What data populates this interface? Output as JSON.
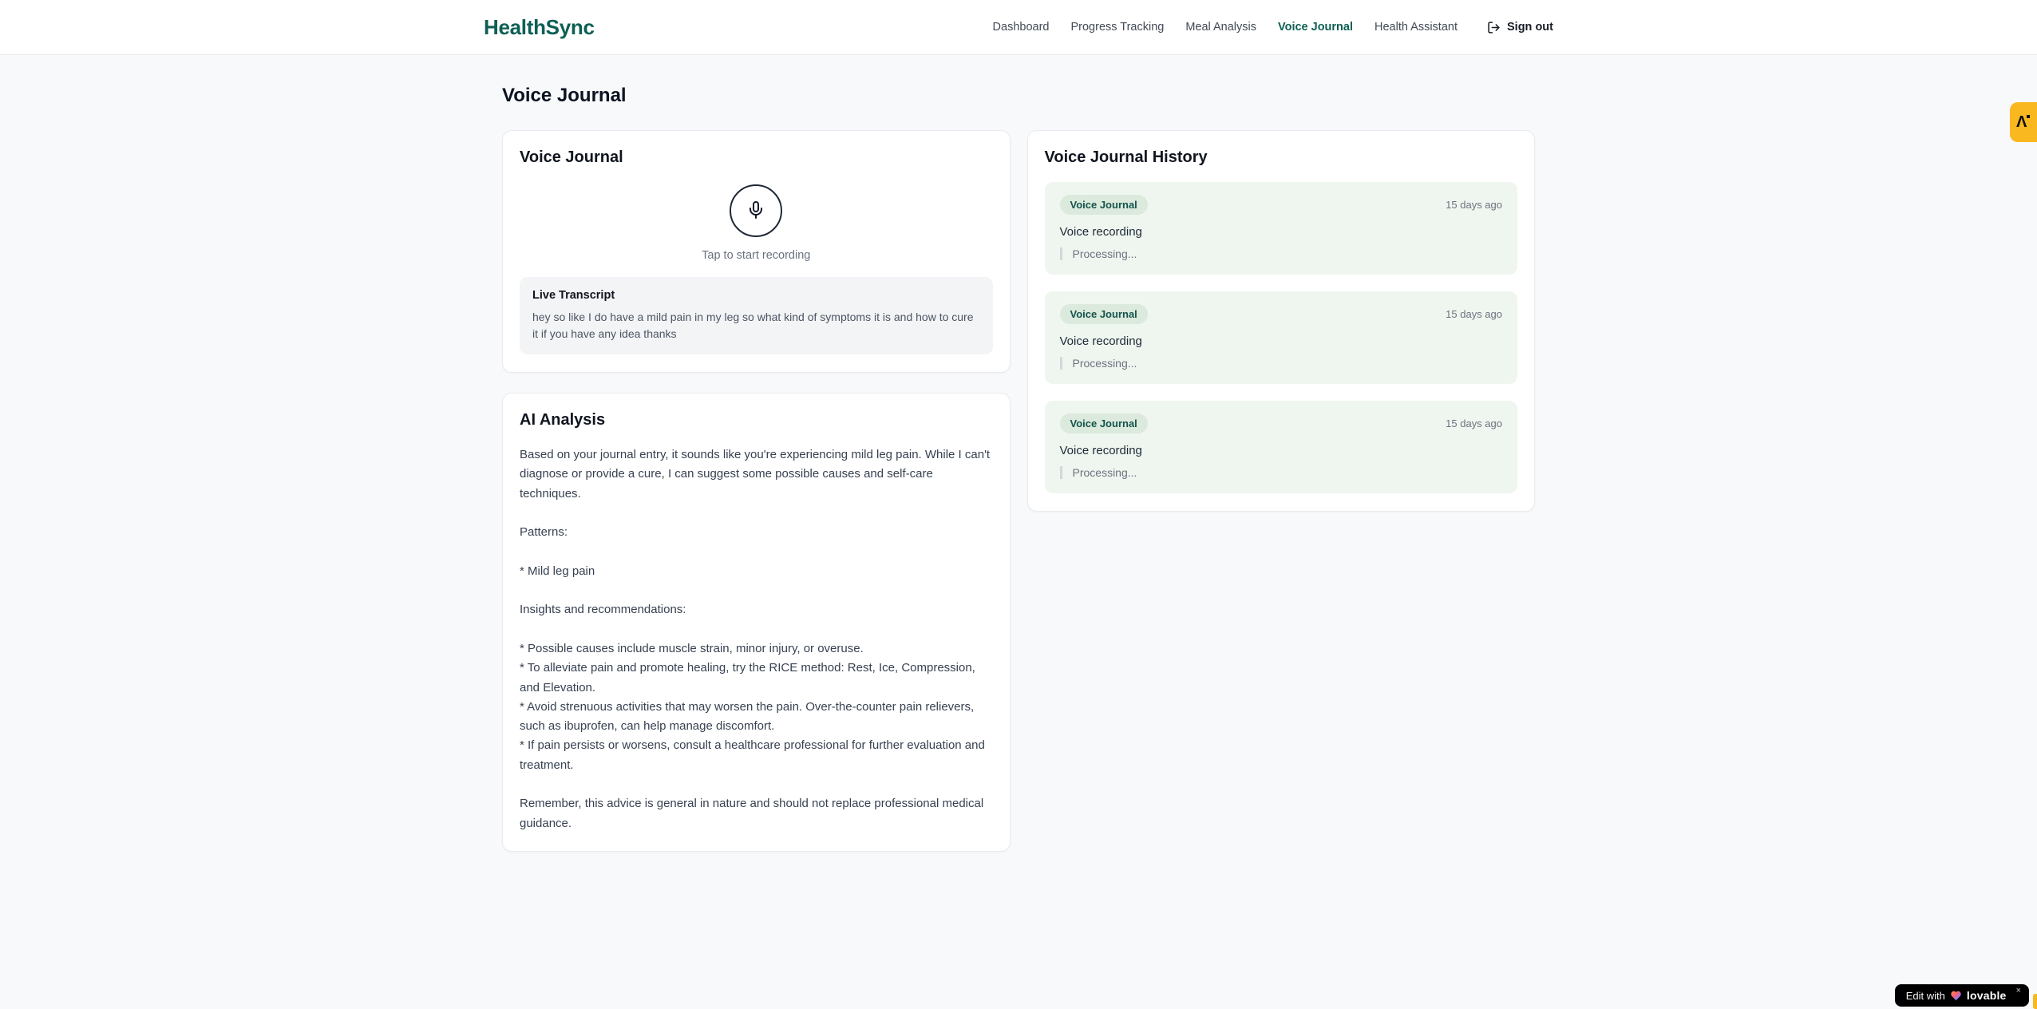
{
  "brand": {
    "name": "HealthSync",
    "color": "#0d5f54"
  },
  "nav": {
    "items": [
      {
        "label": "Dashboard",
        "active": false
      },
      {
        "label": "Progress Tracking",
        "active": false
      },
      {
        "label": "Meal Analysis",
        "active": false
      },
      {
        "label": "Voice Journal",
        "active": true
      },
      {
        "label": "Health Assistant",
        "active": false
      }
    ],
    "sign_out_label": "Sign out"
  },
  "page": {
    "title": "Voice Journal"
  },
  "recorder_card": {
    "title": "Voice Journal",
    "tap_hint": "Tap to start recording",
    "transcript_title": "Live Transcript",
    "transcript_text": "hey so like I do have a mild pain in my leg so what kind of symptoms it is and how to cure it if you have any idea thanks"
  },
  "analysis_card": {
    "title": "AI Analysis",
    "body": "Based on your journal entry, it sounds like you're experiencing mild leg pain. While I can't diagnose or provide a cure, I can suggest some possible causes and self-care techniques.\n\nPatterns:\n\n* Mild leg pain\n\nInsights and recommendations:\n\n* Possible causes include muscle strain, minor injury, or overuse.\n* To alleviate pain and promote healing, try the RICE method: Rest, Ice, Compression, and Elevation.\n* Avoid strenuous activities that may worsen the pain. Over-the-counter pain relievers, such as ibuprofen, can help manage discomfort.\n* If pain persists or worsens, consult a healthcare professional for further evaluation and treatment.\n\nRemember, this advice is general in nature and should not replace professional medical guidance."
  },
  "history_card": {
    "title": "Voice Journal History",
    "entries": [
      {
        "badge": "Voice Journal",
        "time": "15 days ago",
        "title": "Voice recording",
        "status": "Processing..."
      },
      {
        "badge": "Voice Journal",
        "time": "15 days ago",
        "title": "Voice recording",
        "status": "Processing..."
      },
      {
        "badge": "Voice Journal",
        "time": "15 days ago",
        "title": "Voice recording",
        "status": "Processing..."
      }
    ]
  },
  "floating": {
    "side_tag_glyph": "Λ",
    "edit_label": "Edit with",
    "edit_brand": "lovable",
    "close_glyph": "×",
    "accent_amber": "#f9b81f",
    "entry_green": "#eff6ef"
  }
}
